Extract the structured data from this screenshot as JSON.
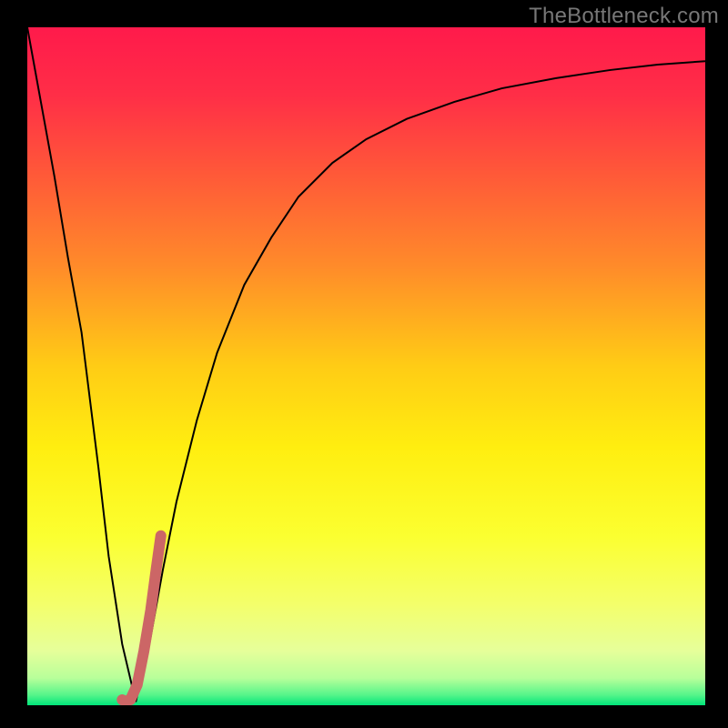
{
  "watermark": "TheBottleneck.com",
  "chart_data": {
    "type": "line",
    "title": "",
    "xlabel": "",
    "ylabel": "",
    "xlim": [
      0,
      100
    ],
    "ylim": [
      0,
      100
    ],
    "legend": false,
    "grid": false,
    "background_gradient": {
      "stops": [
        {
          "pos": 0.0,
          "color": "#ff1a4b"
        },
        {
          "pos": 0.1,
          "color": "#ff2e47"
        },
        {
          "pos": 0.22,
          "color": "#ff5a38"
        },
        {
          "pos": 0.35,
          "color": "#ff8a2a"
        },
        {
          "pos": 0.5,
          "color": "#ffcc15"
        },
        {
          "pos": 0.62,
          "color": "#ffee10"
        },
        {
          "pos": 0.75,
          "color": "#fbff30"
        },
        {
          "pos": 0.85,
          "color": "#f4ff6a"
        },
        {
          "pos": 0.92,
          "color": "#e6ff9a"
        },
        {
          "pos": 0.96,
          "color": "#b8ff9a"
        },
        {
          "pos": 0.985,
          "color": "#55f58a"
        },
        {
          "pos": 1.0,
          "color": "#00e57a"
        }
      ]
    },
    "series": [
      {
        "name": "bottleneck-curve",
        "color": "#000000",
        "width": 2,
        "x": [
          0,
          2,
          4,
          6,
          8,
          9.5,
          10.5,
          12,
          14,
          16,
          18,
          20,
          22,
          25,
          28,
          32,
          36,
          40,
          45,
          50,
          56,
          63,
          70,
          78,
          86,
          93,
          100
        ],
        "y": [
          100,
          89,
          78,
          66,
          55,
          43,
          35,
          22,
          9,
          0.5,
          9,
          20,
          30,
          42,
          52,
          62,
          69,
          75,
          80,
          83.5,
          86.5,
          89,
          91,
          92.5,
          93.7,
          94.5,
          95
        ]
      },
      {
        "name": "highlight-segment",
        "color": "#cc6666",
        "width": 12,
        "linecap": "round",
        "x": [
          14.0,
          14.5,
          15.2,
          16.2,
          17.2,
          18.2,
          19.0,
          19.7
        ],
        "y": [
          0.8,
          0.6,
          0.8,
          3.0,
          8.0,
          14.0,
          20.0,
          25.0
        ]
      }
    ]
  }
}
